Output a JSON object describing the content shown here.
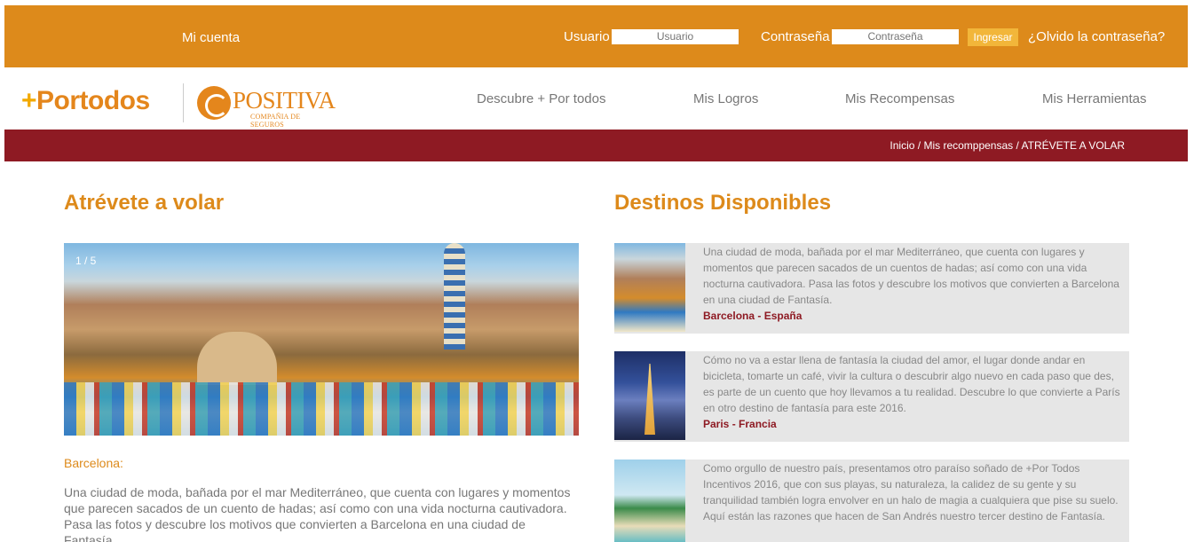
{
  "topbar": {
    "account": "Mi cuenta",
    "user_label": "Usuario",
    "user_placeholder": "Usuario",
    "pass_label": "Contraseña",
    "pass_placeholder": "Contraseña",
    "login_button": "Ingresar",
    "forgot": "¿Olvido la contraseña?"
  },
  "brand": {
    "portodos_plus": "+",
    "portodos_text": "Portodos",
    "positiva_name": "POSITIVA",
    "positiva_sub": "COMPAÑIA DE SEGUROS"
  },
  "nav": [
    "Descubre + Por todos",
    "Mis Logros",
    "Mis Recompensas",
    "Mis Herramientas"
  ],
  "breadcrumb": {
    "home": "Inicio",
    "sep": " / ",
    "section": "Mis recomppensas",
    "current": "ATRÉVETE A VOLAR"
  },
  "left": {
    "title": "Atrévete a volar",
    "slider_counter": "1 / 5",
    "city_label": "Barcelona:",
    "text": "Una ciudad de moda, bañada por el mar Mediterráneo, que cuenta con lugares y momentos que parecen sacados de un cuento de hadas; así como con una vida nocturna cautivadora. Pasa las fotos y descubre los motivos que convierten a Barcelona en una ciudad de Fantasía."
  },
  "right": {
    "title": "Destinos Disponibles",
    "cards": [
      {
        "text": "Una ciudad de moda, bañada por el mar Mediterráneo, que cuenta con lugares y momentos que parecen sacados de un cuentos de hadas; así como con una vida nocturna cautivadora. Pasa las fotos y descubre los motivos que convierten a Barcelona en una ciudad de Fantasía.",
        "place": "Barcelona - España"
      },
      {
        "text": "Cómo no va a estar llena de fantasía la ciudad del amor, el lugar donde andar en bicicleta, tomarte un café, vivir la cultura o descubrir algo nuevo en cada paso que des, es parte de un cuento que hoy llevamos a tu realidad. Descubre lo que convierte a París en otro destino de fantasía para este 2016.",
        "place": "Paris - Francia"
      },
      {
        "text": "Como orgullo de nuestro país, presentamos otro paraíso soñado de +Por Todos Incentivos 2016, que con sus playas, su naturaleza, la calidez de su gente y su tranquilidad también logra envolver en un halo de magia a cualquiera que pise su suelo. Aquí están las razones que hacen de San Andrés nuestro tercer destino de Fantasía.",
        "place": ""
      }
    ]
  },
  "colors": {
    "orange": "#dd8a1b",
    "maroon": "#8e1a23",
    "card_bg": "#e6e6e6"
  }
}
